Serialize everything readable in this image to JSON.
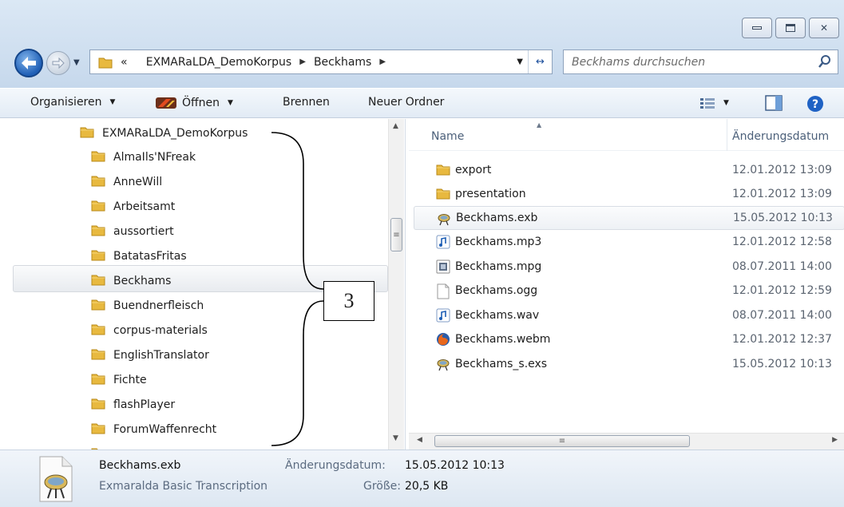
{
  "window": {
    "controls": [
      "minimize",
      "maximize",
      "close"
    ]
  },
  "nav": {
    "breadcrumb_prefix": "«",
    "breadcrumb": [
      "EXMARaLDA_DemoKorpus",
      "Beckhams"
    ],
    "search_placeholder": "Beckhams durchsuchen"
  },
  "toolbar": {
    "organize": "Organisieren",
    "open": "Öffnen",
    "burn": "Brennen",
    "new_folder": "Neuer Ordner"
  },
  "tree": {
    "root": "EXMARaLDA_DemoKorpus",
    "items": [
      "AlmaIls'NFreak",
      "AnneWill",
      "Arbeitsamt",
      "aussortiert",
      "BatatasFritas",
      "Beckhams",
      "Buendnerfleisch",
      "corpus-materials",
      "EnglishTranslator",
      "Fichte",
      "flashPlayer",
      "ForumWaffenrecht"
    ],
    "selected": "Beckhams"
  },
  "columns": {
    "name": "Name",
    "date": "Änderungsdatum"
  },
  "files": [
    {
      "name": "export",
      "date": "12.01.2012 13:09",
      "icon": "folder-icon"
    },
    {
      "name": "presentation",
      "date": "12.01.2012 13:09",
      "icon": "folder-icon"
    },
    {
      "name": "Beckhams.exb",
      "date": "15.05.2012 10:13",
      "icon": "exmaralda-icon"
    },
    {
      "name": "Beckhams.mp3",
      "date": "12.01.2012 12:58",
      "icon": "audio-icon"
    },
    {
      "name": "Beckhams.mpg",
      "date": "08.07.2011 14:00",
      "icon": "video-icon"
    },
    {
      "name": "Beckhams.ogg",
      "date": "12.01.2012 12:59",
      "icon": "blank-file-icon"
    },
    {
      "name": "Beckhams.wav",
      "date": "08.07.2011 14:00",
      "icon": "audio-icon"
    },
    {
      "name": "Beckhams.webm",
      "date": "12.01.2012 12:37",
      "icon": "firefox-icon"
    },
    {
      "name": "Beckhams_s.exs",
      "date": "15.05.2012 10:13",
      "icon": "exmaralda-icon"
    }
  ],
  "selected_file": "Beckhams.exb",
  "details": {
    "filename": "Beckhams.exb",
    "type": "Exmaralda Basic Transcription",
    "modified_label": "Änderungsdatum:",
    "modified_value": "15.05.2012 10:13",
    "size_label": "Größe:",
    "size_value": "20,5 KB"
  },
  "annotation": {
    "label": "3"
  }
}
